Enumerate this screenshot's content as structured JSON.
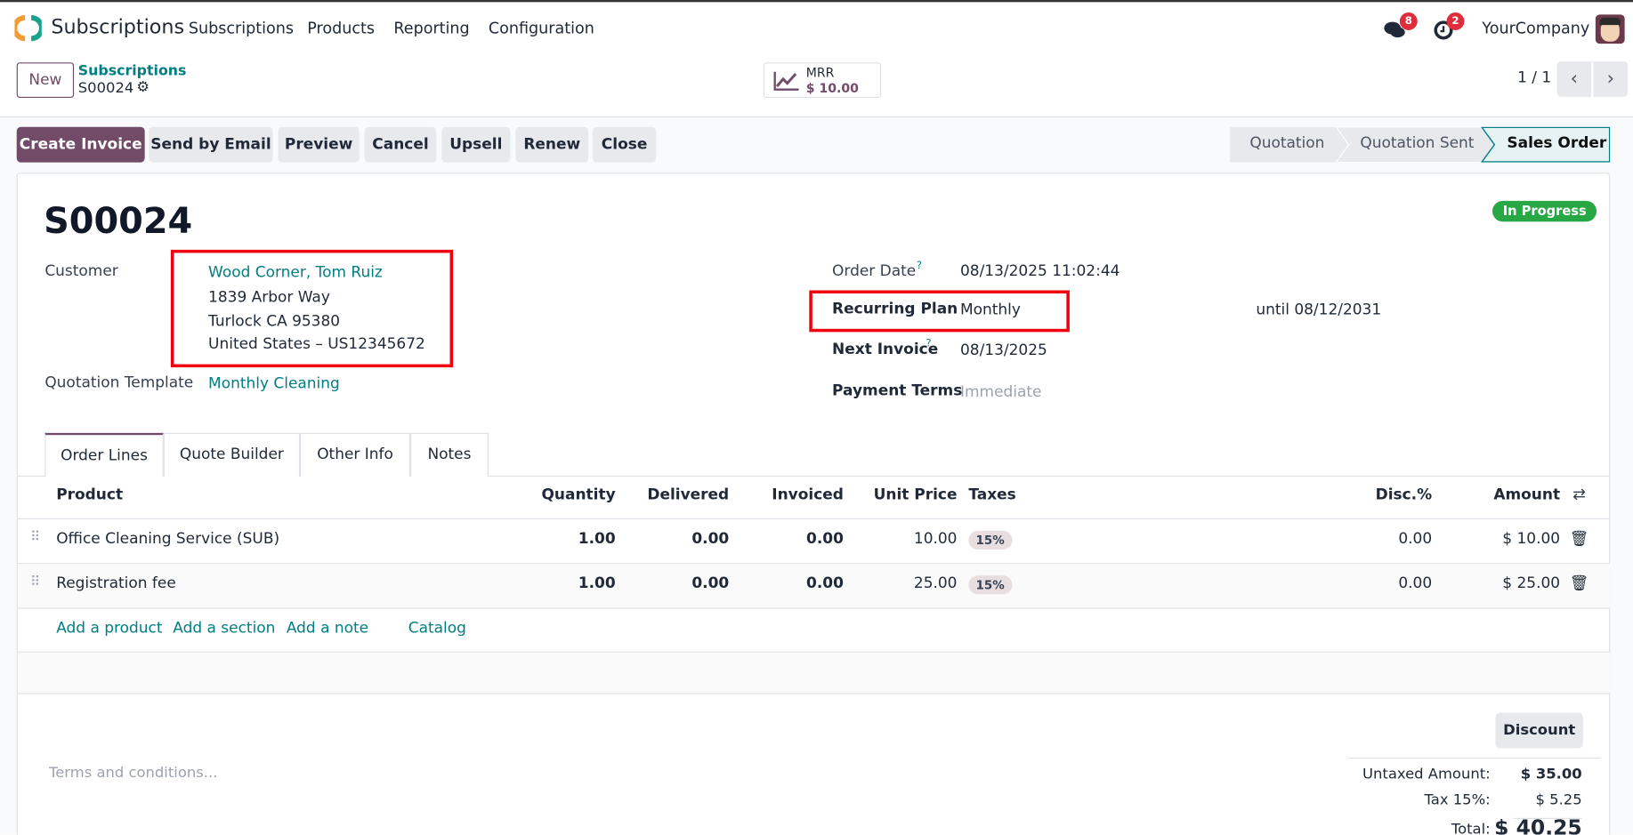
{
  "app": {
    "name": "Subscriptions",
    "menu": [
      "Subscriptions",
      "Products",
      "Reporting",
      "Configuration"
    ],
    "messages_count": "8",
    "activities_count": "2",
    "company": "YourCompany"
  },
  "control_panel": {
    "new_label": "New",
    "breadcrumb_parent": "Subscriptions",
    "breadcrumb_current": "S00024",
    "mrr_label": "MRR",
    "mrr_value": "$ 10.00",
    "pager": "1 / 1"
  },
  "actions": [
    "Create Invoice",
    "Send by Email",
    "Preview",
    "Cancel",
    "Upsell",
    "Renew",
    "Close"
  ],
  "statusbar": {
    "stages": [
      "Quotation",
      "Quotation Sent",
      "Sales Order"
    ],
    "active": "Sales Order"
  },
  "record": {
    "name": "S00024",
    "status": "In Progress",
    "customer_label": "Customer",
    "customer_name": "Wood Corner, Tom Ruiz",
    "address": [
      "1839 Arbor Way",
      "Turlock CA 95380",
      "United States – US12345672"
    ],
    "template_label": "Quotation Template",
    "template": "Monthly Cleaning",
    "order_date_label": "Order Date",
    "order_date": "08/13/2025 11:02:44",
    "plan_label": "Recurring Plan",
    "plan": "Monthly",
    "until": "until 08/12/2031",
    "next_invoice_label": "Next Invoice",
    "next_invoice": "08/13/2025",
    "payment_terms_label": "Payment Terms",
    "payment_terms": "Immediate",
    "help_mark": "?"
  },
  "tabs": [
    "Order Lines",
    "Quote Builder",
    "Other Info",
    "Notes"
  ],
  "table": {
    "headers": {
      "product": "Product",
      "quantity": "Quantity",
      "delivered": "Delivered",
      "invoiced": "Invoiced",
      "unit_price": "Unit Price",
      "taxes": "Taxes",
      "disc": "Disc.%",
      "amount": "Amount"
    },
    "rows": [
      {
        "product": "Office Cleaning Service (SUB)",
        "quantity": "1.00",
        "delivered": "0.00",
        "invoiced": "0.00",
        "unit_price": "10.00",
        "tax": "15%",
        "disc": "0.00",
        "amount": "$ 10.00"
      },
      {
        "product": "Registration fee",
        "quantity": "1.00",
        "delivered": "0.00",
        "invoiced": "0.00",
        "unit_price": "25.00",
        "tax": "15%",
        "disc": "0.00",
        "amount": "$ 25.00"
      }
    ],
    "add_links": [
      "Add a product",
      "Add a section",
      "Add a note",
      "Catalog"
    ]
  },
  "footer": {
    "terms_placeholder": "Terms and conditions...",
    "discount_label": "Discount",
    "untaxed_label": "Untaxed Amount:",
    "untaxed": "$ 35.00",
    "tax_label": "Tax 15%:",
    "tax": "$ 5.25",
    "total_label": "Total:",
    "total": "$ 40.25"
  },
  "colors": {
    "brand": "#714b67",
    "link": "#017e84",
    "status_green": "#28a745",
    "highlight": "#f0000f"
  }
}
